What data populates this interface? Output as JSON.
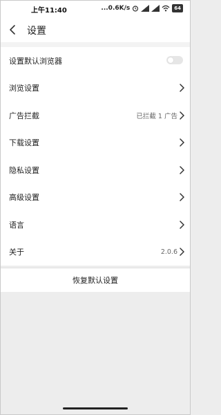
{
  "statusbar": {
    "time": "上午11:40",
    "network_speed": "...0.6K/s",
    "battery": "64"
  },
  "header": {
    "title": "设置"
  },
  "settings": {
    "items": [
      {
        "label": "设置默认浏览器",
        "type": "toggle",
        "toggle_on": false
      },
      {
        "label": "浏览设置",
        "type": "link"
      },
      {
        "label": "广告拦截",
        "type": "link",
        "value": "已拦截 1 广告"
      },
      {
        "label": "下载设置",
        "type": "link"
      },
      {
        "label": "隐私设置",
        "type": "link"
      },
      {
        "label": "高级设置",
        "type": "link"
      },
      {
        "label": "语言",
        "type": "link"
      },
      {
        "label": "关于",
        "type": "link",
        "value": "2.0.6"
      }
    ],
    "reset_label": "恢复默认设置"
  },
  "icons": {
    "back": "chevron-left-icon",
    "chevron": "chevron-right-icon"
  },
  "colors": {
    "background": "#ededed",
    "surface": "#ffffff",
    "text_primary": "#222222",
    "text_secondary": "#666666"
  }
}
